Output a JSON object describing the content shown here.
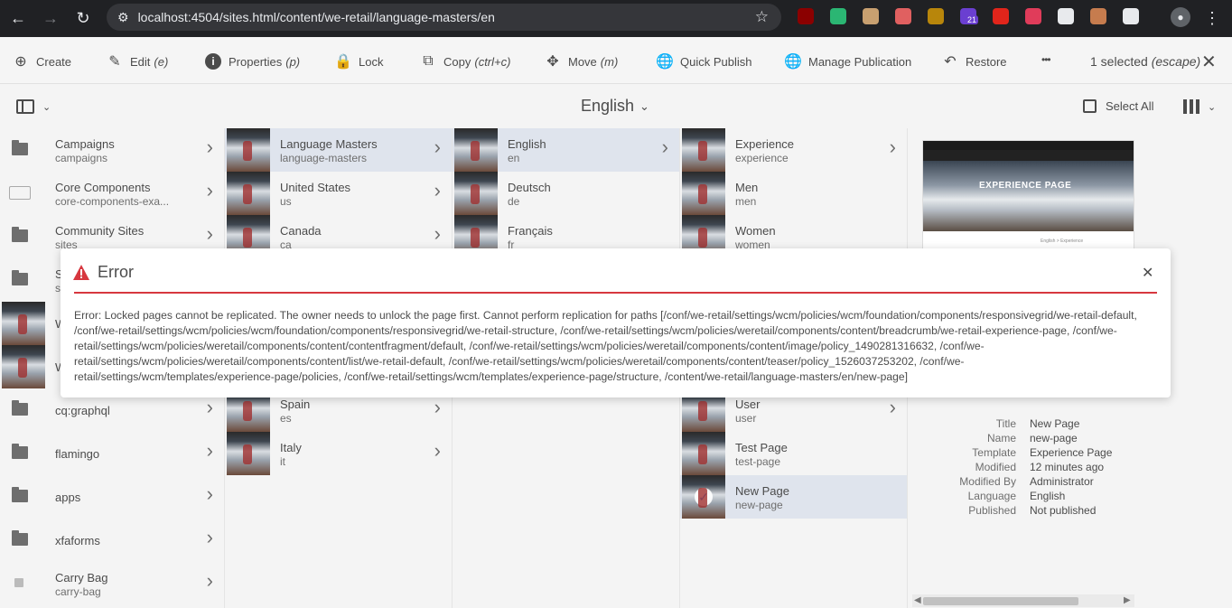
{
  "browser": {
    "url": "localhost:4504/sites.html/content/we-retail/language-masters/en",
    "extensions": [
      {
        "name": "ublock-icon",
        "color": "#8b0000"
      },
      {
        "name": "diamond-ext-icon",
        "color": "#2bb673"
      },
      {
        "name": "owl-ext-icon",
        "color": "#c8a070"
      },
      {
        "name": "eraser-ext-icon",
        "color": "#e06060"
      },
      {
        "name": "lion-ext-icon",
        "color": "#b8860b"
      },
      {
        "name": "badge-ext-icon",
        "color": "#6a3fd1",
        "badge": "21"
      },
      {
        "name": "adobe-ext-icon",
        "color": "#e1251b"
      },
      {
        "name": "stack-ext-icon",
        "color": "#e03c5a"
      },
      {
        "name": "circle-ext-icon",
        "color": "#e8eaed"
      },
      {
        "name": "cookie-ext-icon",
        "color": "#c67c4e"
      },
      {
        "name": "puzzle-ext-icon",
        "color": "#e8eaed"
      }
    ]
  },
  "actionbar": {
    "create": "Create",
    "edit": "Edit",
    "edit_sc": "(e)",
    "properties": "Properties",
    "properties_sc": "(p)",
    "lock": "Lock",
    "copy": "Copy",
    "copy_sc": "(ctrl+c)",
    "move": "Move",
    "move_sc": "(m)",
    "quick_publish": "Quick Publish",
    "manage_publication": "Manage Publication",
    "restore": "Restore",
    "more": "•••",
    "selected": "1 selected",
    "selected_sc": "(escape)"
  },
  "titlebar": {
    "heading": "English",
    "select_all": "Select All"
  },
  "col1": [
    {
      "title": "Campaigns",
      "sub": "campaigns"
    },
    {
      "title": "Core Components",
      "sub": "core-components-exa..."
    },
    {
      "title": "Community Sites",
      "sub": "sites"
    },
    {
      "title": "S",
      "sub": "s"
    },
    {
      "title": "W",
      "sub": ""
    },
    {
      "title": "W",
      "sub": ""
    },
    {
      "title": "cq:graphql",
      "sub": ""
    },
    {
      "title": "flamingo",
      "sub": ""
    },
    {
      "title": "apps",
      "sub": ""
    },
    {
      "title": "xfaforms",
      "sub": ""
    },
    {
      "title": "Carry Bag",
      "sub": "carry-bag"
    }
  ],
  "col2": [
    {
      "title": "Language Masters",
      "sub": "language-masters"
    },
    {
      "title": "United States",
      "sub": "us"
    },
    {
      "title": "Canada",
      "sub": "ca"
    },
    {
      "title": "Spain",
      "sub": "es"
    },
    {
      "title": "Italy",
      "sub": "it"
    }
  ],
  "col3": [
    {
      "title": "English",
      "sub": "en"
    },
    {
      "title": "Deutsch",
      "sub": "de"
    },
    {
      "title": "Français",
      "sub": "fr"
    }
  ],
  "col4": [
    {
      "title": "Experience",
      "sub": "experience"
    },
    {
      "title": "Men",
      "sub": "men"
    },
    {
      "title": "Women",
      "sub": "women"
    },
    {
      "title": "User",
      "sub": "user"
    },
    {
      "title": "Test Page",
      "sub": "test-page"
    },
    {
      "title": "New Page",
      "sub": "new-page"
    }
  ],
  "preview": {
    "hero_title": "EXPERIENCE PAGE",
    "crumb": "English  >  Experience",
    "meta": [
      {
        "k": "Title",
        "v": "New Page"
      },
      {
        "k": "Name",
        "v": "new-page"
      },
      {
        "k": "Template",
        "v": "Experience Page"
      },
      {
        "k": "Modified",
        "v": "12 minutes ago"
      },
      {
        "k": "Modified By",
        "v": "Administrator"
      },
      {
        "k": "Language",
        "v": "English"
      },
      {
        "k": "Published",
        "v": "Not published"
      }
    ]
  },
  "dialog": {
    "title": "Error",
    "message": "Error: Locked pages cannot be replicated. The owner needs to unlock the page first. Cannot perform replication for paths [/conf/we-retail/settings/wcm/policies/wcm/foundation/components/responsivegrid/we-retail-default, /conf/we-retail/settings/wcm/policies/wcm/foundation/components/responsivegrid/we-retail-structure, /conf/we-retail/settings/wcm/policies/weretail/components/content/breadcrumb/we-retail-experience-page, /conf/we-retail/settings/wcm/policies/weretail/components/content/contentfragment/default, /conf/we-retail/settings/wcm/policies/weretail/components/content/image/policy_1490281316632, /conf/we-retail/settings/wcm/policies/weretail/components/content/list/we-retail-default, /conf/we-retail/settings/wcm/policies/weretail/components/content/teaser/policy_1526037253202, /conf/we-retail/settings/wcm/templates/experience-page/policies, /conf/we-retail/settings/wcm/templates/experience-page/structure, /content/we-retail/language-masters/en/new-page]",
    "accent": "#d7373f"
  }
}
